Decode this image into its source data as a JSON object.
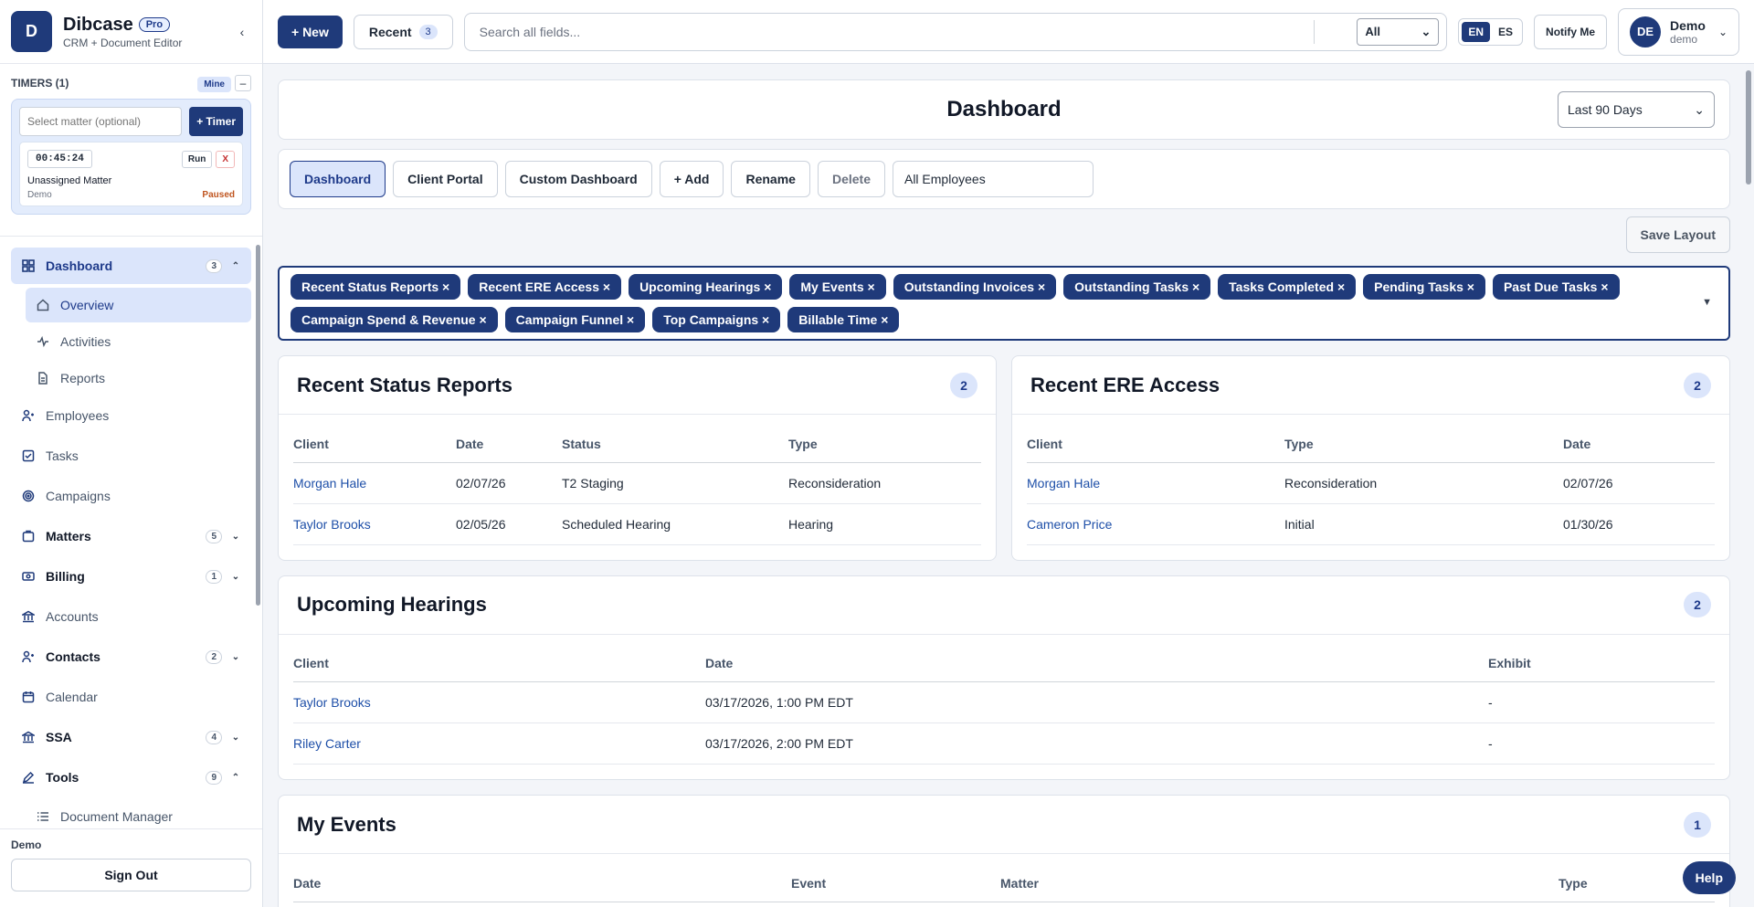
{
  "brand": {
    "logo": "D",
    "name": "Dibcase",
    "badge": "Pro",
    "subtitle": "CRM + Document Editor"
  },
  "timers": {
    "title": "TIMERS (1)",
    "mine": "Mine",
    "minus": "–",
    "matter_placeholder": "Select matter (optional)",
    "add": "+ Timer",
    "card": {
      "time": "00:45:24",
      "run": "Run",
      "close": "X",
      "matter": "Unassigned Matter",
      "user": "Demo",
      "status": "Paused"
    }
  },
  "nav": {
    "dashboard": {
      "label": "Dashboard",
      "count": "3"
    },
    "sub": {
      "overview": "Overview",
      "activities": "Activities",
      "reports": "Reports"
    },
    "employees": "Employees",
    "tasks": "Tasks",
    "campaigns": "Campaigns",
    "matters": {
      "label": "Matters",
      "count": "5"
    },
    "billing": {
      "label": "Billing",
      "count": "1"
    },
    "accounts": "Accounts",
    "contacts": {
      "label": "Contacts",
      "count": "2"
    },
    "calendar": "Calendar",
    "ssa": {
      "label": "SSA",
      "count": "4"
    },
    "tools": {
      "label": "Tools",
      "count": "9"
    },
    "document_manager": "Document Manager"
  },
  "footer": {
    "user": "Demo",
    "signout": "Sign Out"
  },
  "topbar": {
    "new": "+ New",
    "recent": "Recent",
    "recent_count": "3",
    "search_placeholder": "Search all fields...",
    "search_scope": "All",
    "lang_en": "EN",
    "lang_es": "ES",
    "notify": "Notify Me",
    "user": {
      "initials": "DE",
      "name": "Demo",
      "role": "demo"
    }
  },
  "dashboard": {
    "title": "Dashboard",
    "range": "Last 90 Days",
    "tabs": [
      "Dashboard",
      "Client Portal",
      "Custom Dashboard",
      "+ Add",
      "Rename",
      "Delete"
    ],
    "employee_filter": "All Employees",
    "save_layout": "Save Layout",
    "chips": [
      "Recent Status Reports ×",
      "Recent ERE Access ×",
      "Upcoming Hearings ×",
      "My Events ×",
      "Outstanding Invoices ×",
      "Outstanding Tasks ×",
      "Tasks Completed ×",
      "Pending Tasks ×",
      "Past Due Tasks ×",
      "Campaign Spend & Revenue ×",
      "Campaign Funnel ×",
      "Top Campaigns ×",
      "Billable Time ×"
    ]
  },
  "status_reports": {
    "title": "Recent Status Reports",
    "count": "2",
    "headers": [
      "Client",
      "Date",
      "Status",
      "Type"
    ],
    "rows": [
      [
        "Morgan Hale",
        "02/07/26",
        "T2 Staging",
        "Reconsideration"
      ],
      [
        "Taylor Brooks",
        "02/05/26",
        "Scheduled Hearing",
        "Hearing"
      ]
    ]
  },
  "ere_access": {
    "title": "Recent ERE Access",
    "count": "2",
    "headers": [
      "Client",
      "Type",
      "Date"
    ],
    "rows": [
      [
        "Morgan Hale",
        "Reconsideration",
        "02/07/26"
      ],
      [
        "Cameron Price",
        "Initial",
        "01/30/26"
      ]
    ]
  },
  "hearings": {
    "title": "Upcoming Hearings",
    "count": "2",
    "headers": [
      "Client",
      "Date",
      "Exhibit"
    ],
    "rows": [
      [
        "Taylor Brooks",
        "03/17/2026, 1:00 PM EDT",
        "-"
      ],
      [
        "Riley Carter",
        "03/17/2026, 2:00 PM EDT",
        "-"
      ]
    ]
  },
  "events": {
    "title": "My Events",
    "count": "1",
    "headers": [
      "Date",
      "Event",
      "Matter",
      "Type"
    ]
  },
  "help": "Help",
  "colors": {
    "primary": "#1f3a7a",
    "accent_bg": "#dbe5fb",
    "link": "#1e4fa8",
    "paused": "#c05621"
  }
}
